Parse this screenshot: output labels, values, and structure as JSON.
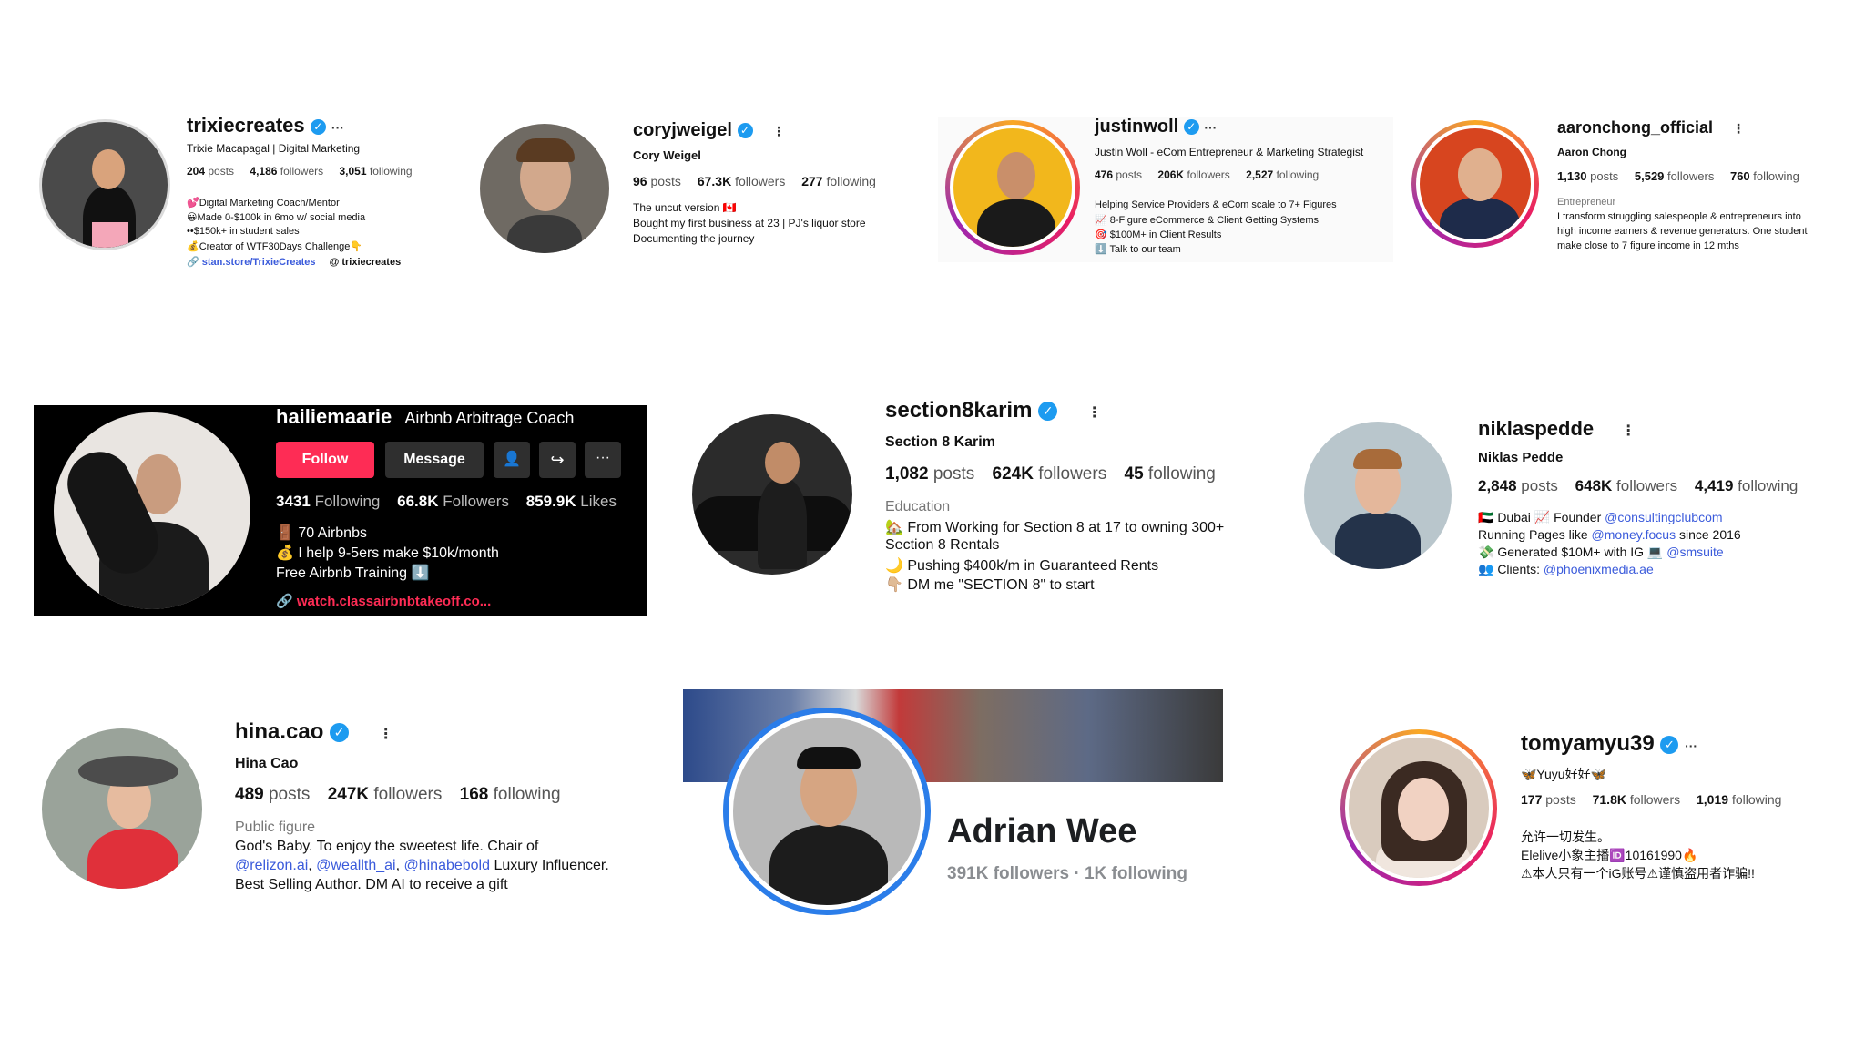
{
  "profiles": {
    "trixie": {
      "username": "trixiecreates",
      "name": "Trixie Macapagal | Digital Marketing",
      "posts": "204",
      "posts_label": "posts",
      "followers": "4,186",
      "followers_label": "followers",
      "following": "3,051",
      "following_label": "following",
      "bio": [
        "💕Digital Marketing Coach/Mentor",
        "😀Made 0-$100k in 6mo w/ social media",
        "••$150k+ in student sales",
        "💰Creator of WTF30Days Challenge👇"
      ],
      "link": "stan.store/TrixieCreates",
      "threads": "trixiecreates"
    },
    "cory": {
      "username": "coryjweigel",
      "name": "Cory Weigel",
      "posts": "96",
      "posts_label": "posts",
      "followers": "67.3K",
      "followers_label": "followers",
      "following": "277",
      "following_label": "following",
      "bio": [
        "The uncut version 🇨🇦",
        "Bought my first business at 23 | PJ's liquor store",
        "Documenting the journey"
      ]
    },
    "justin": {
      "username": "justinwoll",
      "name": "Justin Woll - eCom Entrepreneur & Marketing Strategist",
      "posts": "476",
      "posts_label": "posts",
      "followers": "206K",
      "followers_label": "followers",
      "following": "2,527",
      "following_label": "following",
      "bio": [
        "Helping Service Providers & eCom scale to 7+ Figures",
        "📈 8-Figure eCommerce & Client Getting Systems",
        "🎯 $100M+ in Client Results",
        "⬇️ Talk to our team"
      ]
    },
    "aaron": {
      "username": "aaronchong_official",
      "name": "Aaron Chong",
      "posts": "1,130",
      "posts_label": "posts",
      "followers": "5,529",
      "followers_label": "followers",
      "following": "760",
      "following_label": "following",
      "category": "Entrepreneur",
      "bio": [
        "I transform struggling salespeople & entrepreneurs into",
        "high income earners & revenue generators. One student",
        "make close to 7 figure income in 12 mths"
      ]
    },
    "hailie": {
      "username": "hailiemaarie",
      "title": "Airbnb Arbitrage Coach",
      "follow_label": "Follow",
      "message_label": "Message",
      "following": "3431",
      "following_label": "Following",
      "followers": "66.8K",
      "followers_label": "Followers",
      "likes": "859.9K",
      "likes_label": "Likes",
      "bio": [
        "🚪 70 Airbnbs",
        "💰 I help 9-5ers make $10k/month",
        "Free Airbnb Training ⬇️"
      ],
      "link": "watch.classairbnbtakeoff.co..."
    },
    "karim": {
      "username": "section8karim",
      "name": "Section 8 Karim",
      "posts": "1,082",
      "posts_label": "posts",
      "followers": "624K",
      "followers_label": "followers",
      "following": "45",
      "following_label": "following",
      "category": "Education",
      "bio": [
        "🏡 From Working for Section 8 at 17 to owning 300+",
        "Section 8 Rentals",
        "🌙 Pushing $400k/m in Guaranteed Rents",
        "👇🏼 DM me \"SECTION 8\" to start"
      ]
    },
    "niklas": {
      "username": "niklaspedde",
      "name": "Niklas Pedde",
      "posts": "2,848",
      "posts_label": "posts",
      "followers": "648K",
      "followers_label": "followers",
      "following": "4,419",
      "following_label": "following",
      "bio1_pre": "🇦🇪 Dubai 📈 Founder ",
      "bio1_link": "@consultingclubcom",
      "bio2_pre": "Running Pages like ",
      "bio2_link": "@money.focus",
      "bio2_post": " since 2016",
      "bio3_pre": "💸 Generated $10M+ with IG 💻 ",
      "bio3_link": "@smsuite",
      "bio4_pre": "👥 Clients: ",
      "bio4_link": "@phoenixmedia.ae"
    },
    "hina": {
      "username": "hina.cao",
      "name": "Hina Cao",
      "posts": "489",
      "posts_label": "posts",
      "followers": "247K",
      "followers_label": "followers",
      "following": "168",
      "following_label": "following",
      "category": "Public figure",
      "bio1": "God's Baby. To enjoy the sweetest life. Chair of",
      "bio2_link1": "@relizon.ai",
      "bio2_sep1": ", ",
      "bio2_link2": "@weallth_ai",
      "bio2_sep2": ", ",
      "bio2_link3": "@hinabebold",
      "bio2_post": " Luxury Influencer.",
      "bio3": "Best Selling Author. DM AI to receive a gift"
    },
    "adrian": {
      "name": "Adrian Wee",
      "stats": "391K followers · 1K following"
    },
    "tomyamyu": {
      "username": "tomyamyu39",
      "name": "🦋Yuyu好好🦋",
      "posts": "177",
      "posts_label": "posts",
      "followers": "71.8K",
      "followers_label": "followers",
      "following": "1,019",
      "following_label": "following",
      "bio": [
        "允许一切发生。",
        "Elelive小象主播🆔10161990🔥",
        "⚠本人只有一个iG账号⚠谨慎盗用者诈骗!!"
      ]
    }
  },
  "colors": {
    "verified": "#1d9bf0",
    "follow_button": "#fe2c55",
    "link": "#3b5bdb",
    "tiktok_bg": "#000000"
  },
  "icons": {
    "verified": "verified-badge-icon",
    "more": "more-options-icon",
    "link": "link-icon",
    "threads": "threads-icon"
  }
}
